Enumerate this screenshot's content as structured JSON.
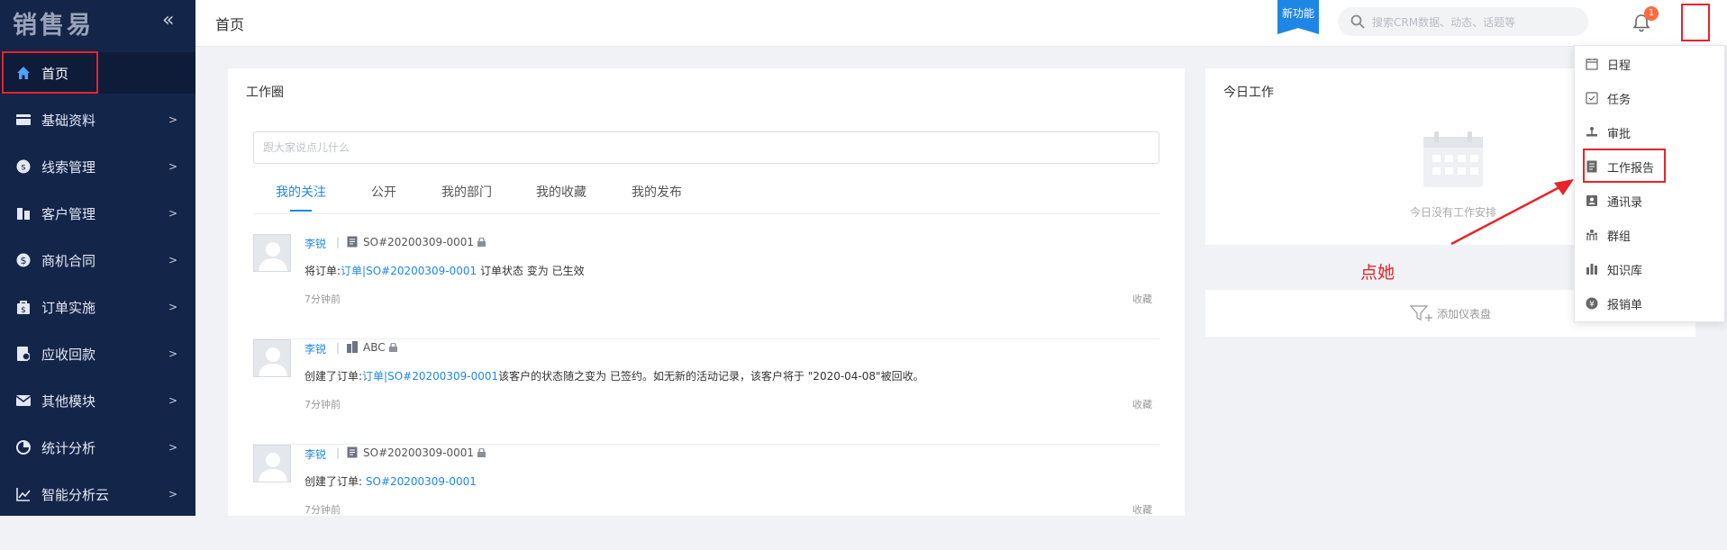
{
  "sidebar": {
    "logo": "销售易",
    "collapse_glyph": "«",
    "items": [
      {
        "label": "首页",
        "icon": "home-icon"
      },
      {
        "label": "基础资料",
        "icon": "card-icon"
      },
      {
        "label": "线索管理",
        "icon": "lead-icon"
      },
      {
        "label": "客户管理",
        "icon": "building-icon"
      },
      {
        "label": "商机合同",
        "icon": "dollar-icon"
      },
      {
        "label": "订单实施",
        "icon": "bag-icon"
      },
      {
        "label": "应收回款",
        "icon": "receivable-icon"
      },
      {
        "label": "其他模块",
        "icon": "mail-icon"
      },
      {
        "label": "统计分析",
        "icon": "pie-icon"
      },
      {
        "label": "智能分析云",
        "icon": "line-chart-icon"
      }
    ]
  },
  "header": {
    "breadcrumb": "首页",
    "new_feature": "新功能",
    "search_placeholder": "搜索CRM数据、动态、话题等",
    "notification_count": "1"
  },
  "work_circle": {
    "title": "工作圈",
    "post_placeholder": "跟大家说点儿什么",
    "tabs": [
      "我的关注",
      "公开",
      "我的部门",
      "我的收藏",
      "我的发布"
    ],
    "feed": [
      {
        "author": "李锐",
        "object": "SO#20200309-0001",
        "pre": "将订单:",
        "link": "订单|SO#20200309-0001",
        "post": "订单状态 变为 已生效",
        "time": "7分钟前",
        "fav": "收藏"
      },
      {
        "author": "李锐",
        "object": "ABC",
        "pre": "创建了订单:",
        "link": "订单|SO#20200309-0001",
        "post": "该客户的状态随之变为 已签约。如无新的活动记录，该客户将于 \"2020-04-08\"被回收。",
        "time": "7分钟前",
        "fav": "收藏"
      },
      {
        "author": "李锐",
        "object": "SO#20200309-0001",
        "pre": "创建了订单:",
        "link": "SO#20200309-0001",
        "post": "",
        "time": "7分钟前",
        "fav": "收藏"
      }
    ]
  },
  "today": {
    "title": "今日工作",
    "empty_text": "今日没有工作安排",
    "add_dashboard": "添加仪表盘"
  },
  "dropdown": {
    "items": [
      {
        "label": "日程",
        "icon": "calendar-icon"
      },
      {
        "label": "任务",
        "icon": "task-icon"
      },
      {
        "label": "审批",
        "icon": "stamp-icon"
      },
      {
        "label": "工作报告",
        "icon": "report-icon"
      },
      {
        "label": "通讯录",
        "icon": "contacts-icon"
      },
      {
        "label": "群组",
        "icon": "group-icon"
      },
      {
        "label": "知识库",
        "icon": "knowledge-icon"
      },
      {
        "label": "报销单",
        "icon": "yen-icon"
      }
    ]
  },
  "annotation": "点她",
  "colors": {
    "sidebar_bg": "#14254a",
    "accent": "#1e87e6",
    "annotation_red": "#e8232a"
  }
}
